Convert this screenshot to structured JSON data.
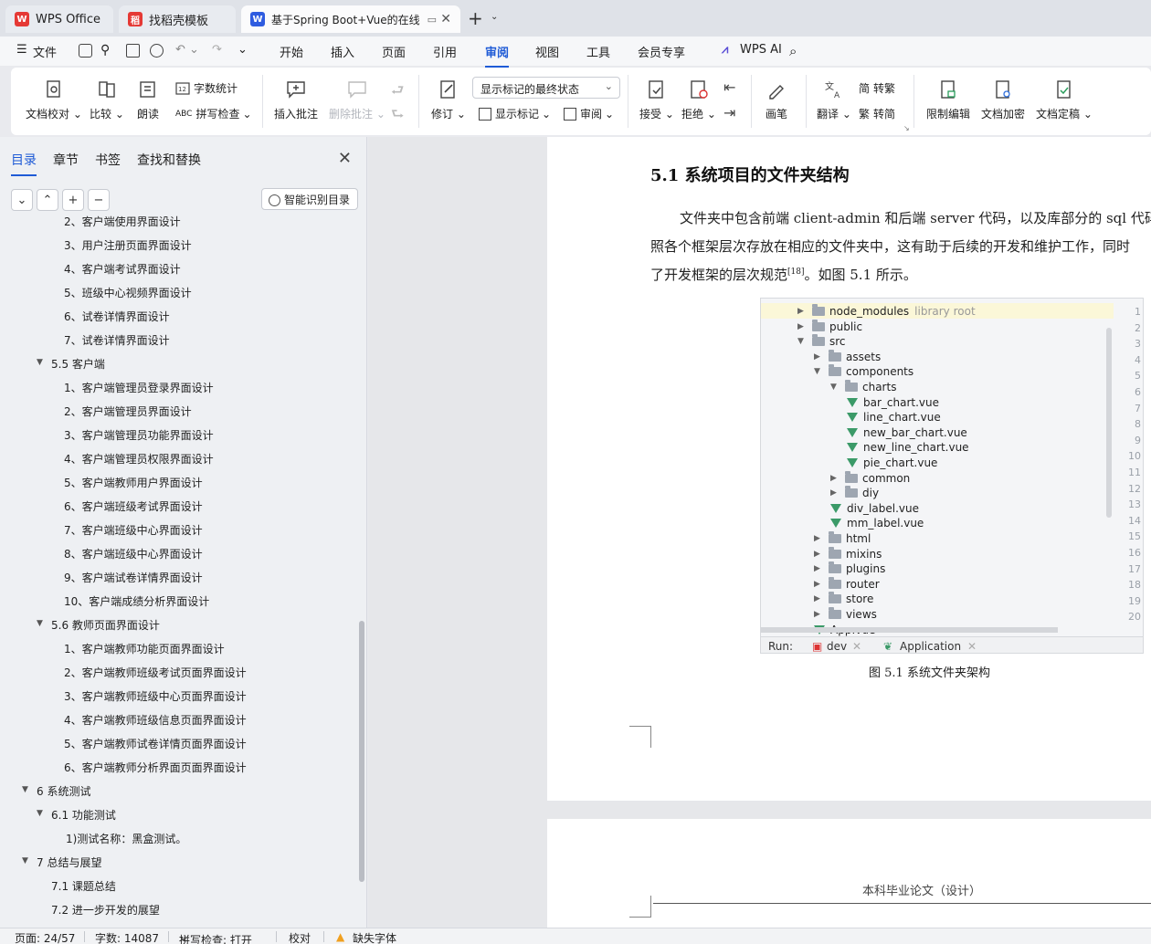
{
  "tabs": [
    {
      "label": "WPS Office",
      "icon": "wps-logo-icon",
      "color": "#e53935"
    },
    {
      "label": "找稻壳模板",
      "icon": "docer-icon",
      "color": "#e53935"
    },
    {
      "label": "基于Spring Boot+Vue的在线",
      "icon": "word-doc-icon",
      "color": "#2f5ce0"
    }
  ],
  "menu": {
    "file": "文件",
    "items": [
      "开始",
      "插入",
      "页面",
      "引用",
      "审阅",
      "视图",
      "工具",
      "会员专享"
    ],
    "active": "审阅",
    "ai": "WPS AI"
  },
  "ribbon": {
    "doc_check": "文档校对",
    "compare": "比较",
    "read_aloud": "朗读",
    "word_count": "字数统计",
    "spell_check": "拼写检查",
    "insert_comment": "插入批注",
    "delete_comment": "删除批注",
    "revise": "修订",
    "markup_select": "显示标记的最终状态",
    "show_markup": "显示标记",
    "review": "审阅",
    "accept": "接受",
    "reject": "拒绝",
    "pen": "画笔",
    "translate": "翻译",
    "to_traditional": "转繁",
    "to_simplified": "转简",
    "restrict_edit": "限制编辑",
    "doc_encrypt": "文档加密",
    "doc_finalize": "文档定稿"
  },
  "nav": {
    "tabs": [
      "目录",
      "章节",
      "书签",
      "查找和替换"
    ],
    "active_tab": "目录",
    "smart_toc": "智能识别目录",
    "items": [
      {
        "text": "2、客户端使用界面设计",
        "level": 3
      },
      {
        "text": "3、用户注册页面界面设计",
        "level": 3
      },
      {
        "text": "4、客户端考试界面设计",
        "level": 3
      },
      {
        "text": "5、班级中心视频界面设计",
        "level": 3
      },
      {
        "text": "6、试卷详情界面设计",
        "level": 3
      },
      {
        "text": "7、试卷详情界面设计",
        "level": 3
      },
      {
        "text": "5.5  客户端",
        "level": 2,
        "expanded": true
      },
      {
        "text": "1、客户端管理员登录界面设计",
        "level": 3
      },
      {
        "text": "2、客户端管理员界面设计",
        "level": 3
      },
      {
        "text": "3、客户端管理员功能界面设计",
        "level": 3
      },
      {
        "text": "4、客户端管理员权限界面设计",
        "level": 3
      },
      {
        "text": "5、客户端教师用户界面设计",
        "level": 3
      },
      {
        "text": "6、客户端班级考试界面设计",
        "level": 3
      },
      {
        "text": "7、客户端班级中心界面设计",
        "level": 3
      },
      {
        "text": "8、客户端班级中心界面设计",
        "level": 3
      },
      {
        "text": "9、客户端试卷详情界面设计",
        "level": 3
      },
      {
        "text": "10、客户端成绩分析界面设计",
        "level": 3
      },
      {
        "text": "5.6 教师页面界面设计",
        "level": 2,
        "expanded": true
      },
      {
        "text": "1、客户端教师功能页面界面设计",
        "level": 3
      },
      {
        "text": "2、客户端教师班级考试页面界面设计",
        "level": 3
      },
      {
        "text": "3、客户端教师班级中心页面界面设计",
        "level": 3
      },
      {
        "text": "4、客户端教师班级信息页面界面设计",
        "level": 3
      },
      {
        "text": "5、客户端教师试卷详情页面界面设计",
        "level": 3
      },
      {
        "text": "6、客户端教师分析界面页面界面设计",
        "level": 3
      },
      {
        "text": "6 系统测试",
        "level": 1,
        "expanded": true
      },
      {
        "text": "6.1  功能测试",
        "level": 2,
        "expanded": true
      },
      {
        "text": "1)测试名称：黑盒测试。",
        "level": 4
      },
      {
        "text": "7 总结与展望",
        "level": 1,
        "expanded": true
      },
      {
        "text": "7.1  课题总结",
        "level": 2
      },
      {
        "text": "7.2  进一步开发的展望",
        "level": 2
      }
    ]
  },
  "doc": {
    "heading": "5.1  系统项目的文件夹结构",
    "para_line1": "文件夹中包含前端 client-admin 和后端 server 代码，以及库部分的 sql 代码。",
    "para_line2": "照各个框架层次存放在相应的文件夹中，这有助于后续的开发和维护工作，同时",
    "para_line3a": "了开发框架的层次规范",
    "para_ref": "[18]",
    "para_line3b": "。如图 5.1 所示。",
    "caption": "图 5.1  系统文件夹架构",
    "page2_header": "本科毕业论文（设计）"
  },
  "ide": {
    "tree": [
      {
        "name": "node_modules",
        "kind": "folder",
        "depth": 0,
        "state": "closed",
        "note": "library root"
      },
      {
        "name": "public",
        "kind": "folder",
        "depth": 0,
        "state": "closed"
      },
      {
        "name": "src",
        "kind": "folder",
        "depth": 0,
        "state": "open"
      },
      {
        "name": "assets",
        "kind": "folder",
        "depth": 1,
        "state": "closed"
      },
      {
        "name": "components",
        "kind": "folder",
        "depth": 1,
        "state": "open"
      },
      {
        "name": "charts",
        "kind": "folder",
        "depth": 2,
        "state": "open"
      },
      {
        "name": "bar_chart.vue",
        "kind": "vue",
        "depth": 3
      },
      {
        "name": "line_chart.vue",
        "kind": "vue",
        "depth": 3
      },
      {
        "name": "new_bar_chart.vue",
        "kind": "vue",
        "depth": 3
      },
      {
        "name": "new_line_chart.vue",
        "kind": "vue",
        "depth": 3
      },
      {
        "name": "pie_chart.vue",
        "kind": "vue",
        "depth": 3
      },
      {
        "name": "common",
        "kind": "folder",
        "depth": 2,
        "state": "closed"
      },
      {
        "name": "diy",
        "kind": "folder",
        "depth": 2,
        "state": "closed"
      },
      {
        "name": "div_label.vue",
        "kind": "vue",
        "depth": 2
      },
      {
        "name": "mm_label.vue",
        "kind": "vue",
        "depth": 2
      },
      {
        "name": "html",
        "kind": "folder",
        "depth": 1,
        "state": "closed"
      },
      {
        "name": "mixins",
        "kind": "folder",
        "depth": 1,
        "state": "closed"
      },
      {
        "name": "plugins",
        "kind": "folder",
        "depth": 1,
        "state": "closed"
      },
      {
        "name": "router",
        "kind": "folder",
        "depth": 1,
        "state": "closed"
      },
      {
        "name": "store",
        "kind": "folder",
        "depth": 1,
        "state": "closed"
      },
      {
        "name": "views",
        "kind": "folder",
        "depth": 1,
        "state": "closed"
      },
      {
        "name": "App.vue",
        "kind": "vue",
        "depth": 1
      }
    ],
    "line_numbers": [
      "1",
      "2",
      "3",
      "4",
      "5",
      "6",
      "7",
      "8",
      "9",
      "10",
      "11",
      "12",
      "13",
      "14",
      "15",
      "16",
      "17",
      "18",
      "19",
      "20"
    ],
    "run_label": "Run:",
    "run_tabs": [
      "dev",
      "Application"
    ]
  },
  "status": {
    "page": "页面: 24/57",
    "words": "字数: 14087",
    "spell": "拼写检查: 打开",
    "proof": "校对",
    "missing_font": "缺失字体"
  },
  "colors": {
    "accent": "#1f5bd6",
    "vue_green": "#3b9a68",
    "warning": "#f0a020"
  }
}
